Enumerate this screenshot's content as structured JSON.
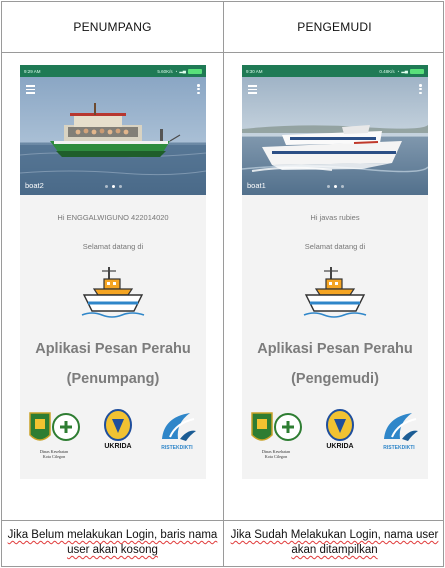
{
  "columns": [
    {
      "header": "PENUMPANG",
      "phone": {
        "status": {
          "time": "9:29 AM",
          "net": "5.60K/s"
        },
        "slide_label": "boat2",
        "greeting": "Hi ENGGALWIGUNO 422014020",
        "welcome": "Selamat datang di",
        "app_title": "Aplikasi Pesan Perahu",
        "app_role": "(Penumpang)",
        "logos": {
          "dinkes_line1": "Dinas Kesehatan",
          "dinkes_line2": "Kota Cilegon",
          "ukrida": "UKRIDA",
          "ristek": "RISTEKDIKTI"
        }
      },
      "caption": "Jika Belum melakukan Login, baris nama user akan kosong"
    },
    {
      "header": "PENGEMUDI",
      "phone": {
        "status": {
          "time": "9:30 AM",
          "net": "0.48K/s"
        },
        "slide_label": "boat1",
        "greeting": "Hi javas rubies",
        "welcome": "Selamat datang di",
        "app_title": "Aplikasi Pesan Perahu",
        "app_role": "(Pengemudi)",
        "logos": {
          "dinkes_line1": "Dinas Kesehatan",
          "dinkes_line2": "Kota Cilegon",
          "ukrida": "UKRIDA",
          "ristek": "RISTEKDIKTI"
        }
      },
      "caption": "Jika Sudah Melakukan Login, nama user akan ditampilkan"
    }
  ],
  "colors": {
    "status_bar": "#1f7a55",
    "title_gray": "#7c7c7c",
    "spell_underline": "#e03b3b"
  }
}
